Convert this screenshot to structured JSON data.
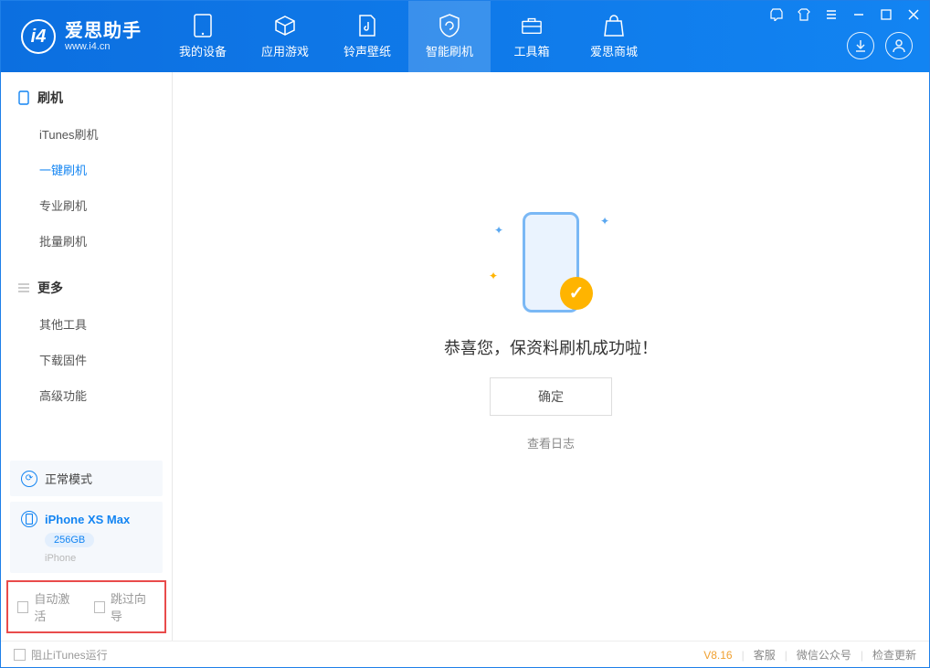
{
  "app": {
    "title": "爱思助手",
    "subtitle": "www.i4.cn"
  },
  "nav": {
    "tabs": [
      {
        "label": "我的设备"
      },
      {
        "label": "应用游戏"
      },
      {
        "label": "铃声壁纸"
      },
      {
        "label": "智能刷机"
      },
      {
        "label": "工具箱"
      },
      {
        "label": "爱思商城"
      }
    ]
  },
  "sidebar": {
    "section1": {
      "title": "刷机",
      "items": [
        "iTunes刷机",
        "一键刷机",
        "专业刷机",
        "批量刷机"
      ]
    },
    "section2": {
      "title": "更多",
      "items": [
        "其他工具",
        "下载固件",
        "高级功能"
      ]
    },
    "mode": "正常模式",
    "device": {
      "name": "iPhone XS Max",
      "capacity": "256GB",
      "type": "iPhone"
    },
    "checks": {
      "auto_activate": "自动激活",
      "skip_guide": "跳过向导"
    }
  },
  "main": {
    "success_text": "恭喜您，保资料刷机成功啦！",
    "ok_button": "确定",
    "view_log": "查看日志"
  },
  "footer": {
    "block_itunes": "阻止iTunes运行",
    "version": "V8.16",
    "links": [
      "客服",
      "微信公众号",
      "检查更新"
    ]
  }
}
